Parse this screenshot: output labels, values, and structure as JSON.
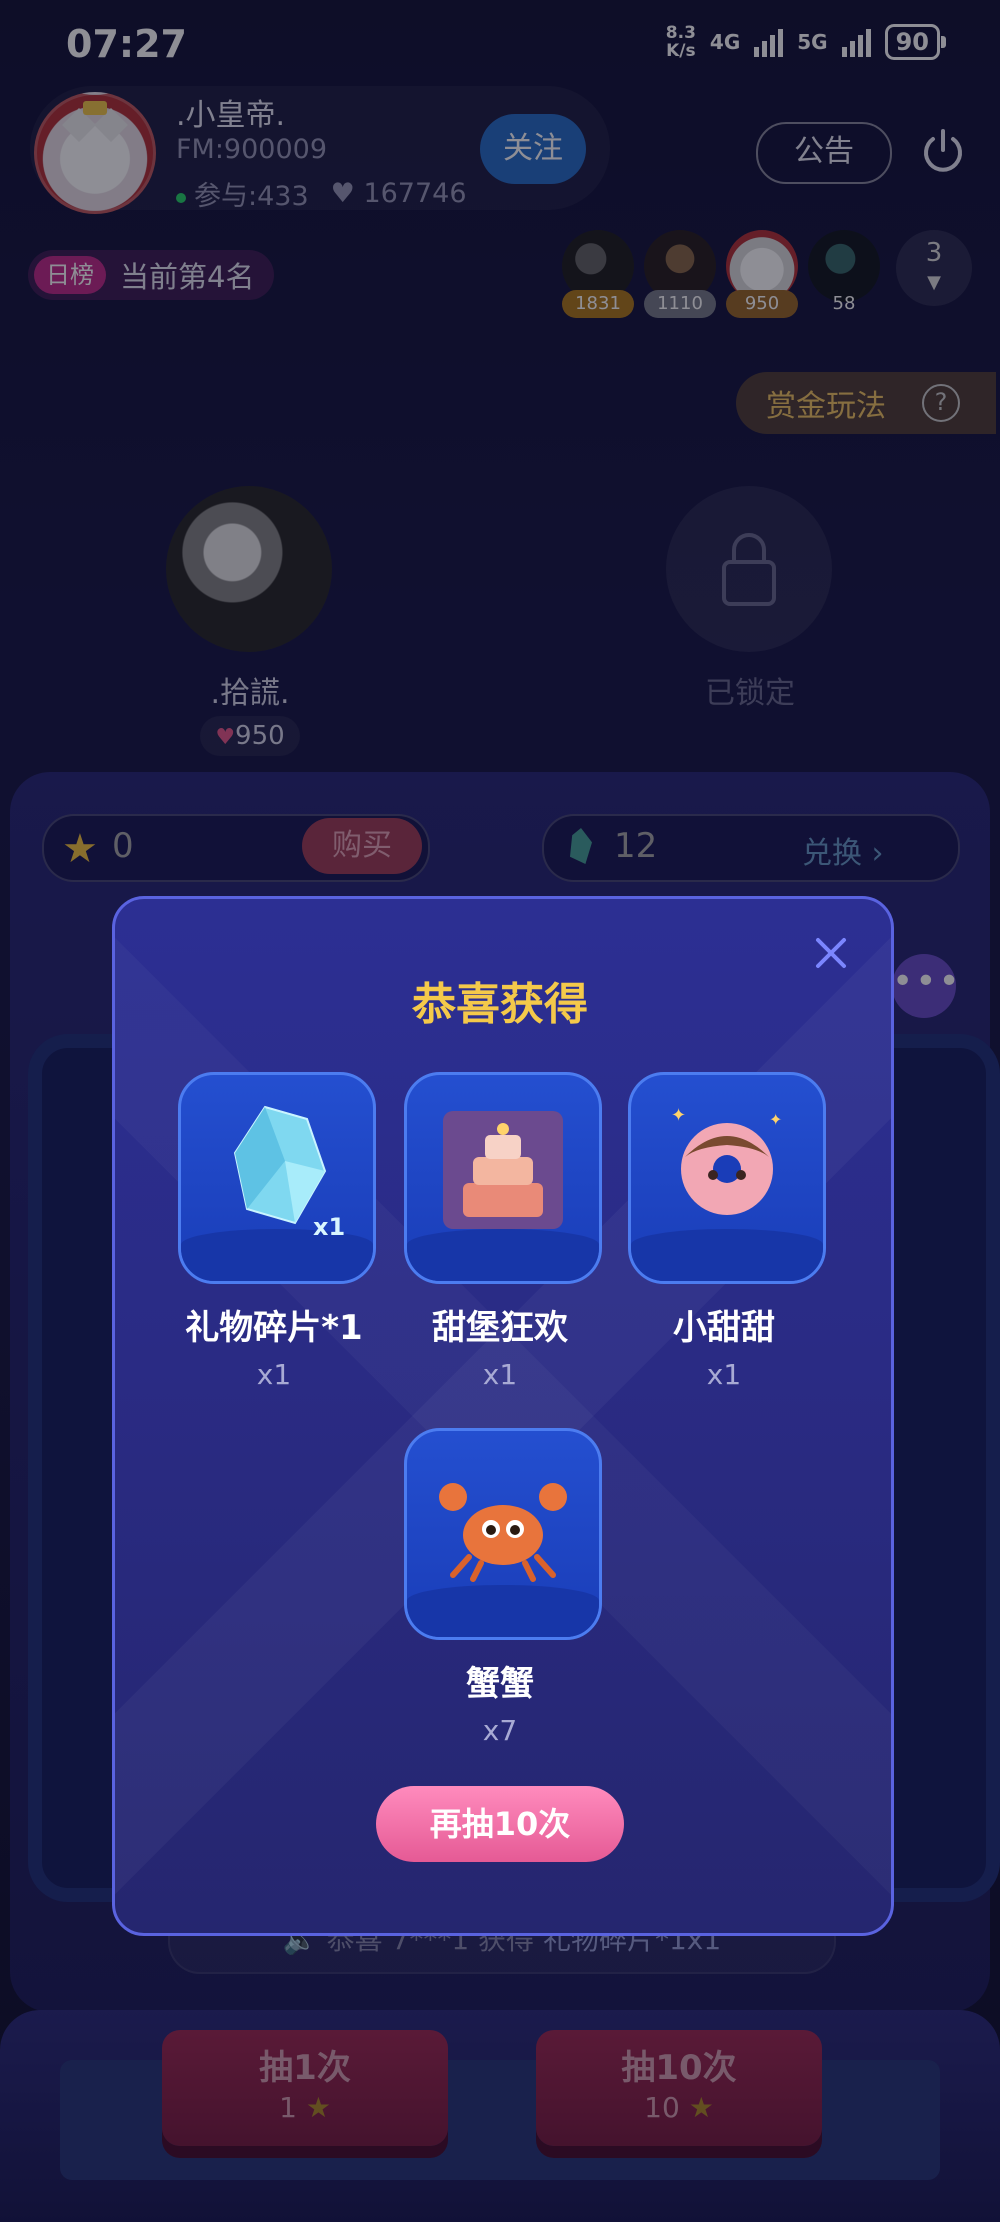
{
  "status": {
    "time": "07:27",
    "net_speed_top": "8.3",
    "net_speed_bottom": "K/s",
    "net1": "4G",
    "net2": "5G",
    "battery": "90"
  },
  "host": {
    "name": ".小皇帝.",
    "fm_id": "FM:900009",
    "participants": "参与:433",
    "likes": "167746",
    "follow_label": "关注"
  },
  "header": {
    "notice_label": "公告"
  },
  "rank": {
    "tag": "日榜",
    "text": "当前第4名"
  },
  "viewers": [
    {
      "score": "1831",
      "color": "#b07a1e"
    },
    {
      "score": "1110",
      "color": "#7b7f8a"
    },
    {
      "score": "950",
      "color": "#9c6a2b"
    },
    {
      "score": "58",
      "color": "transparent"
    }
  ],
  "viewers_more": "3",
  "bounty": {
    "label": "赏金玩法",
    "help": "?"
  },
  "seats": [
    {
      "name": ".拾謊.",
      "likes": "950"
    },
    {
      "locked_label": "已锁定"
    }
  ],
  "wallet": {
    "coins": "0",
    "buy_label": "购买",
    "shards": "12",
    "exchange_label": "兑换"
  },
  "broadcast": {
    "prefix": "恭喜 7***1 获得 ",
    "item": "礼物碎片*1x1"
  },
  "draw": [
    {
      "label": "抽1次",
      "cost": "1"
    },
    {
      "label": "抽10次",
      "cost": "10"
    }
  ],
  "modal": {
    "title": "恭喜获得",
    "prizes": [
      {
        "name": "礼物碎片*1",
        "count": "x1",
        "icon": "crystal-shard-icon",
        "corner": "x1"
      },
      {
        "name": "甜堡狂欢",
        "count": "x1",
        "icon": "cake-castle-icon"
      },
      {
        "name": "小甜甜",
        "count": "x1",
        "icon": "donut-icon"
      },
      {
        "name": "蟹蟹",
        "count": "x7",
        "icon": "crab-icon"
      }
    ],
    "again_label": "再抽10次"
  }
}
